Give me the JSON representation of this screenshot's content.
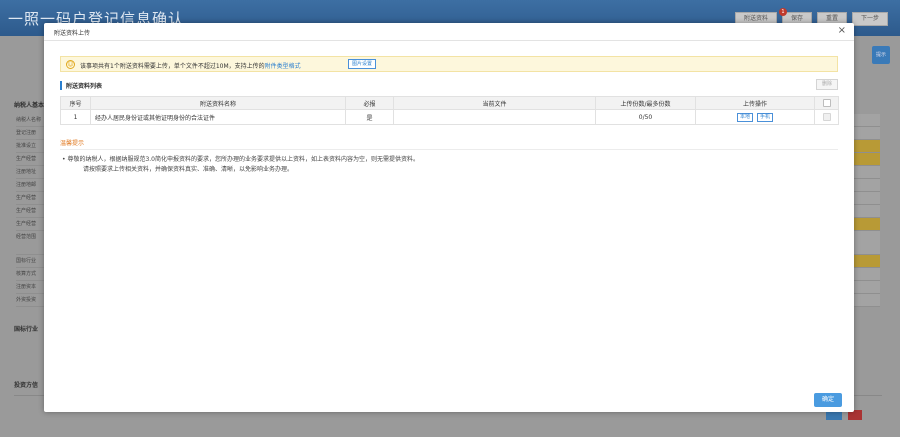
{
  "background": {
    "title": "一照一码户登记信息确认",
    "top_buttons": [
      "附送资料",
      "保存",
      "重置",
      "下一步"
    ],
    "badge_count": "1",
    "right_button": "提示",
    "sections": [
      "纳税人基本",
      "国标行业",
      "投资方信"
    ],
    "row_labels": [
      "纳税人名称",
      "登记注册",
      "批准设立",
      "生产经营",
      "注册地址",
      "注册地邮",
      "生产经营",
      "生产经营",
      "生产经营",
      "经营范围",
      "国标行业",
      "核算方式",
      "注册资本",
      "外资投资"
    ]
  },
  "modal": {
    "title": "附送资料上传",
    "close": "×",
    "notice": {
      "icon": "smile-icon",
      "text_before": "该事项共有1个附送资料需要上传，单个文件不超过10M，支持上传的",
      "link": "附件类型格式",
      "button": "图片设置"
    },
    "list": {
      "title": "附送资料列表",
      "delete_button": "删除",
      "columns": [
        "序号",
        "附送资料名称",
        "必报",
        "当前文件",
        "上传份数/最多份数",
        "上传操作",
        ""
      ],
      "rows": [
        {
          "index": "1",
          "name": "经办人居民身份证或其他证明身份的合法证件",
          "required": "是",
          "current_file": "",
          "count": "0/50",
          "op_local": "本地",
          "op_mobile": "手机"
        }
      ]
    },
    "tips": {
      "title": "温馨提示",
      "line1": "• 尊敬的纳税人，根据纳服规范3.0简化申报资料的要求，您所办理的业务要求提供以上资料，如上表资料内容为空，则无需提供资料。",
      "line2": "请按照要求上传相关资料，并确保资料真实、准确、清晰，以免影响业务办理。"
    },
    "ok_button": "确定"
  }
}
